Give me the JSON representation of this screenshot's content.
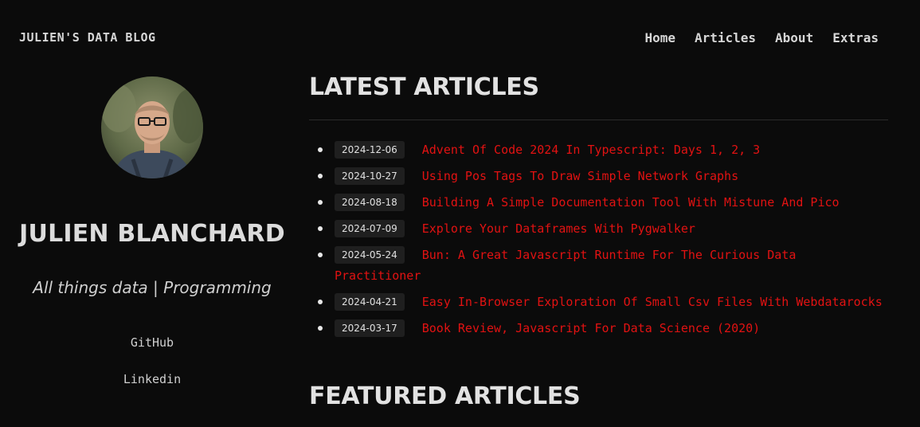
{
  "header": {
    "site_title": "JULIEN'S DATA BLOG",
    "nav": [
      "Home",
      "Articles",
      "About",
      "Extras"
    ]
  },
  "sidebar": {
    "author_name": "JULIEN BLANCHARD",
    "tagline": "All things data | Programming",
    "links": [
      "GitHub",
      "Linkedin"
    ]
  },
  "main": {
    "latest_heading": "LATEST ARTICLES",
    "featured_heading": "FEATURED ARTICLES",
    "articles": [
      {
        "date": "2024-12-06",
        "title": "Advent Of Code 2024 In Typescript: Days 1, 2, 3"
      },
      {
        "date": "2024-10-27",
        "title": "Using Pos Tags To Draw Simple Network Graphs"
      },
      {
        "date": "2024-08-18",
        "title": "Building A Simple Documentation Tool With Mistune And Pico"
      },
      {
        "date": "2024-07-09",
        "title": "Explore Your Dataframes With Pygwalker"
      },
      {
        "date": "2024-05-24",
        "title": "Bun: A Great Javascript Runtime For The Curious Data Practitioner"
      },
      {
        "date": "2024-04-21",
        "title": "Easy In-Browser Exploration Of Small Csv Files With Webdatarocks"
      },
      {
        "date": "2024-03-17",
        "title": "Book Review, Javascript For Data Science (2020)"
      }
    ]
  },
  "colors": {
    "background": "#0b0b0b",
    "link": "#e21212",
    "badge": "#1f1f1f"
  }
}
